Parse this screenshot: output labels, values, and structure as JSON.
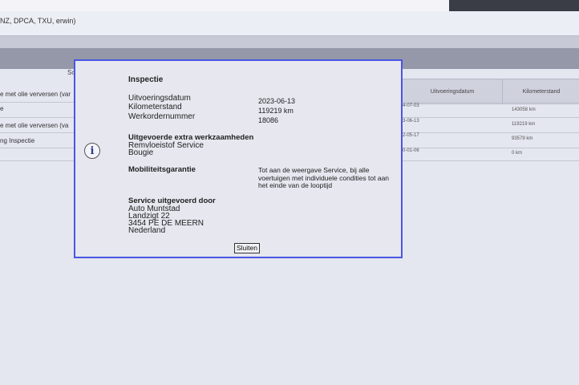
{
  "page": {
    "subtitle": "NZ, DPCA, TXU, erwin)",
    "sort_column_label": "Sc"
  },
  "table": {
    "columns": [
      "Uitvoeringsdatum",
      "Kilometerstand"
    ],
    "rows": [
      {
        "description": "e met olie verversen (var",
        "date": "4-07-03",
        "km": "143058 km"
      },
      {
        "description": "e",
        "date": "3-06-13",
        "km": "119219 km"
      },
      {
        "description": "e met olie verversen (va",
        "date": "2-05-17",
        "km": "93579 km"
      },
      {
        "description": "ng Inspectie",
        "date": "0-01-06",
        "km": "0 km"
      }
    ]
  },
  "dialog": {
    "title": "Inspectie",
    "fields": [
      {
        "label": "Uitvoeringsdatum",
        "value": "2023-06-13"
      },
      {
        "label": "Kilometerstand",
        "value": "119219 km"
      },
      {
        "label": "Werkordernummer",
        "value": "18086"
      }
    ],
    "extra_work_heading": "Uitgevoerde extra werkzaamheden",
    "extra_work": [
      "Remvloeistof Service",
      "Bougie"
    ],
    "mobility_heading": "Mobiliteitsgarantie",
    "mobility_text": "Tot aan de weergave Service, bij alle voertuigen met individuele condities tot aan het einde van de looptijd",
    "service_heading": "Service uitgevoerd door",
    "service_by": [
      "Auto Muntstad",
      "Landzigt 22",
      "3454 PE DE MEERN",
      "Nederland"
    ],
    "close_label": "Sluiten",
    "info_icon_glyph": "i"
  },
  "colors": {
    "dialog_border": "#4a56e0",
    "dialog_background": "#e6e7ef",
    "page_background": "#d9dbe8"
  },
  "icons": {
    "info": "info-icon"
  }
}
